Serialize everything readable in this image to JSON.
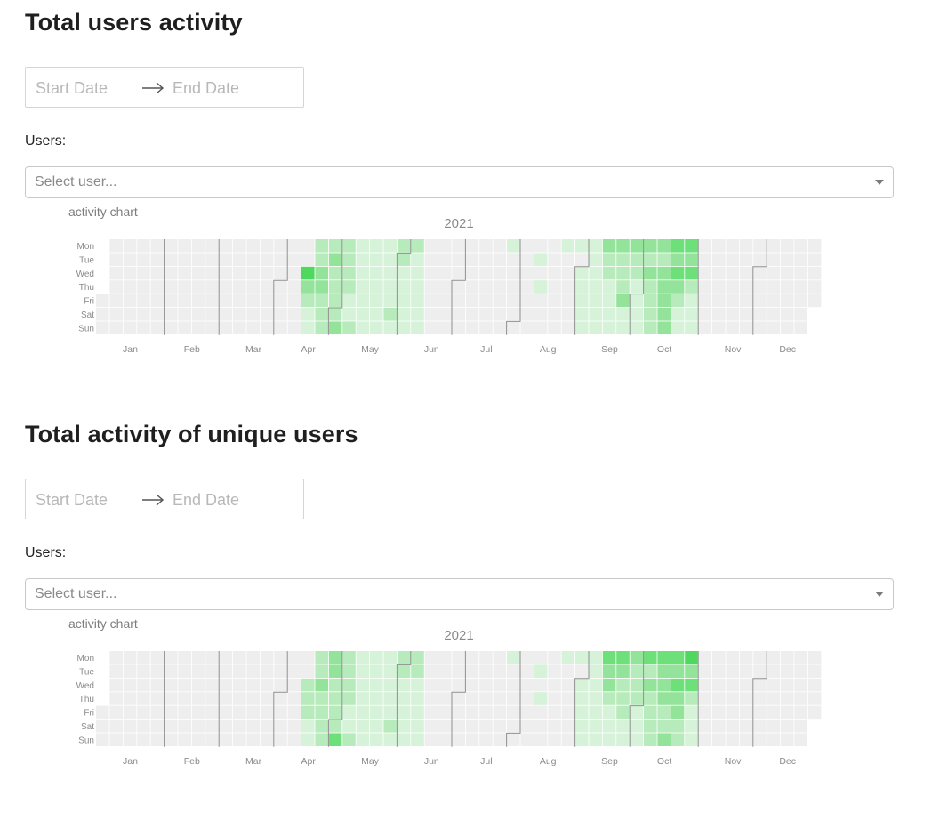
{
  "sections": [
    {
      "heading": "Total users activity",
      "date_range": {
        "start_placeholder": "Start Date",
        "end_placeholder": "End Date"
      },
      "users_label": "Users:",
      "select_placeholder": "Select user...",
      "chart_caption": "activity chart"
    },
    {
      "heading": "Total activity of unique users",
      "date_range": {
        "start_placeholder": "Start Date",
        "end_placeholder": "End Date"
      },
      "users_label": "Users:",
      "select_placeholder": "Select user...",
      "chart_caption": "activity chart"
    }
  ],
  "chart_data": [
    {
      "type": "heatmap",
      "title": "2021",
      "year": 2021,
      "weekday_labels": [
        "Mon",
        "Tue",
        "Wed",
        "Thu",
        "Fri",
        "Sat",
        "Sun"
      ],
      "month_labels": [
        "Jan",
        "Feb",
        "Mar",
        "Apr",
        "May",
        "Jun",
        "Jul",
        "Aug",
        "Sep",
        "Oct",
        "Nov",
        "Dec"
      ],
      "grid": true,
      "colors": [
        "#eeeeee",
        "#d6f2d8",
        "#b8ebbb",
        "#94e39a",
        "#6ee07a",
        "#4ed85e"
      ],
      "level_scale": [
        0,
        1,
        2,
        3,
        4,
        5
      ],
      "weekly_levels_mon_to_sun": {
        "2021-04-12": [
          0,
          0,
          5,
          3,
          2,
          1,
          1
        ],
        "2021-04-19": [
          2,
          2,
          3,
          3,
          2,
          2,
          2
        ],
        "2021-04-26": [
          2,
          3,
          2,
          2,
          2,
          2,
          3
        ],
        "2021-05-03": [
          2,
          2,
          2,
          2,
          1,
          1,
          2
        ],
        "2021-05-10": [
          1,
          1,
          1,
          1,
          1,
          1,
          1
        ],
        "2021-05-17": [
          1,
          1,
          1,
          1,
          1,
          1,
          1
        ],
        "2021-05-24": [
          1,
          1,
          1,
          1,
          1,
          2,
          1
        ],
        "2021-05-31": [
          2,
          2,
          1,
          1,
          1,
          1,
          1
        ],
        "2021-06-07": [
          2,
          1,
          1,
          1,
          1,
          1,
          1
        ],
        "2021-07-26": [
          1,
          0,
          0,
          0,
          0,
          0,
          0
        ],
        "2021-08-02": [
          0,
          0,
          0,
          0,
          0,
          0,
          0
        ],
        "2021-08-09": [
          0,
          1,
          0,
          1,
          0,
          0,
          0
        ],
        "2021-08-16": [
          0,
          0,
          0,
          0,
          0,
          0,
          0
        ],
        "2021-08-23": [
          1,
          0,
          0,
          0,
          0,
          0,
          0
        ],
        "2021-08-30": [
          1,
          0,
          1,
          1,
          1,
          1,
          1
        ],
        "2021-09-06": [
          1,
          1,
          1,
          1,
          1,
          1,
          1
        ],
        "2021-09-13": [
          3,
          2,
          2,
          1,
          1,
          1,
          1
        ],
        "2021-09-20": [
          3,
          2,
          2,
          2,
          3,
          1,
          1
        ],
        "2021-09-27": [
          3,
          2,
          2,
          1,
          1,
          1,
          1
        ],
        "2021-10-04": [
          3,
          2,
          3,
          2,
          2,
          2,
          2
        ],
        "2021-10-11": [
          3,
          2,
          3,
          3,
          3,
          3,
          3
        ],
        "2021-10-18": [
          4,
          3,
          4,
          3,
          2,
          1,
          1
        ],
        "2021-10-25": [
          4,
          3,
          4,
          2,
          1,
          1,
          1
        ]
      }
    },
    {
      "type": "heatmap",
      "title": "2021",
      "year": 2021,
      "weekday_labels": [
        "Mon",
        "Tue",
        "Wed",
        "Thu",
        "Fri",
        "Sat",
        "Sun"
      ],
      "month_labels": [
        "Jan",
        "Feb",
        "Mar",
        "Apr",
        "May",
        "Jun",
        "Jul",
        "Aug",
        "Sep",
        "Oct",
        "Nov",
        "Dec"
      ],
      "grid": true,
      "colors": [
        "#eeeeee",
        "#d6f2d8",
        "#b8ebbb",
        "#94e39a",
        "#6ee07a",
        "#4ed85e"
      ],
      "level_scale": [
        0,
        1,
        2,
        3,
        4,
        5
      ],
      "weekly_levels_mon_to_sun": {
        "2021-04-12": [
          0,
          0,
          2,
          2,
          2,
          1,
          1
        ],
        "2021-04-19": [
          2,
          2,
          3,
          2,
          2,
          2,
          2
        ],
        "2021-04-26": [
          3,
          3,
          2,
          2,
          2,
          2,
          4
        ],
        "2021-05-03": [
          2,
          2,
          2,
          2,
          1,
          1,
          2
        ],
        "2021-05-10": [
          1,
          1,
          1,
          1,
          1,
          1,
          1
        ],
        "2021-05-17": [
          1,
          1,
          1,
          1,
          1,
          1,
          1
        ],
        "2021-05-24": [
          1,
          1,
          1,
          1,
          1,
          2,
          1
        ],
        "2021-05-31": [
          2,
          2,
          1,
          1,
          1,
          1,
          1
        ],
        "2021-06-07": [
          2,
          2,
          1,
          1,
          1,
          1,
          1
        ],
        "2021-07-26": [
          1,
          0,
          0,
          0,
          0,
          0,
          0
        ],
        "2021-08-02": [
          0,
          0,
          0,
          0,
          0,
          0,
          0
        ],
        "2021-08-09": [
          0,
          1,
          0,
          1,
          0,
          0,
          0
        ],
        "2021-08-16": [
          0,
          0,
          0,
          0,
          0,
          0,
          0
        ],
        "2021-08-23": [
          1,
          0,
          0,
          0,
          0,
          0,
          0
        ],
        "2021-08-30": [
          1,
          0,
          1,
          1,
          1,
          1,
          1
        ],
        "2021-09-06": [
          1,
          1,
          1,
          1,
          1,
          1,
          1
        ],
        "2021-09-13": [
          4,
          3,
          3,
          2,
          1,
          1,
          1
        ],
        "2021-09-20": [
          4,
          3,
          2,
          2,
          2,
          1,
          1
        ],
        "2021-09-27": [
          3,
          2,
          2,
          2,
          1,
          1,
          1
        ],
        "2021-10-04": [
          4,
          2,
          3,
          2,
          2,
          2,
          2
        ],
        "2021-10-11": [
          4,
          3,
          3,
          3,
          2,
          2,
          3
        ],
        "2021-10-18": [
          4,
          3,
          4,
          3,
          3,
          2,
          2
        ],
        "2021-10-25": [
          5,
          3,
          4,
          2,
          1,
          1,
          1
        ]
      }
    }
  ]
}
